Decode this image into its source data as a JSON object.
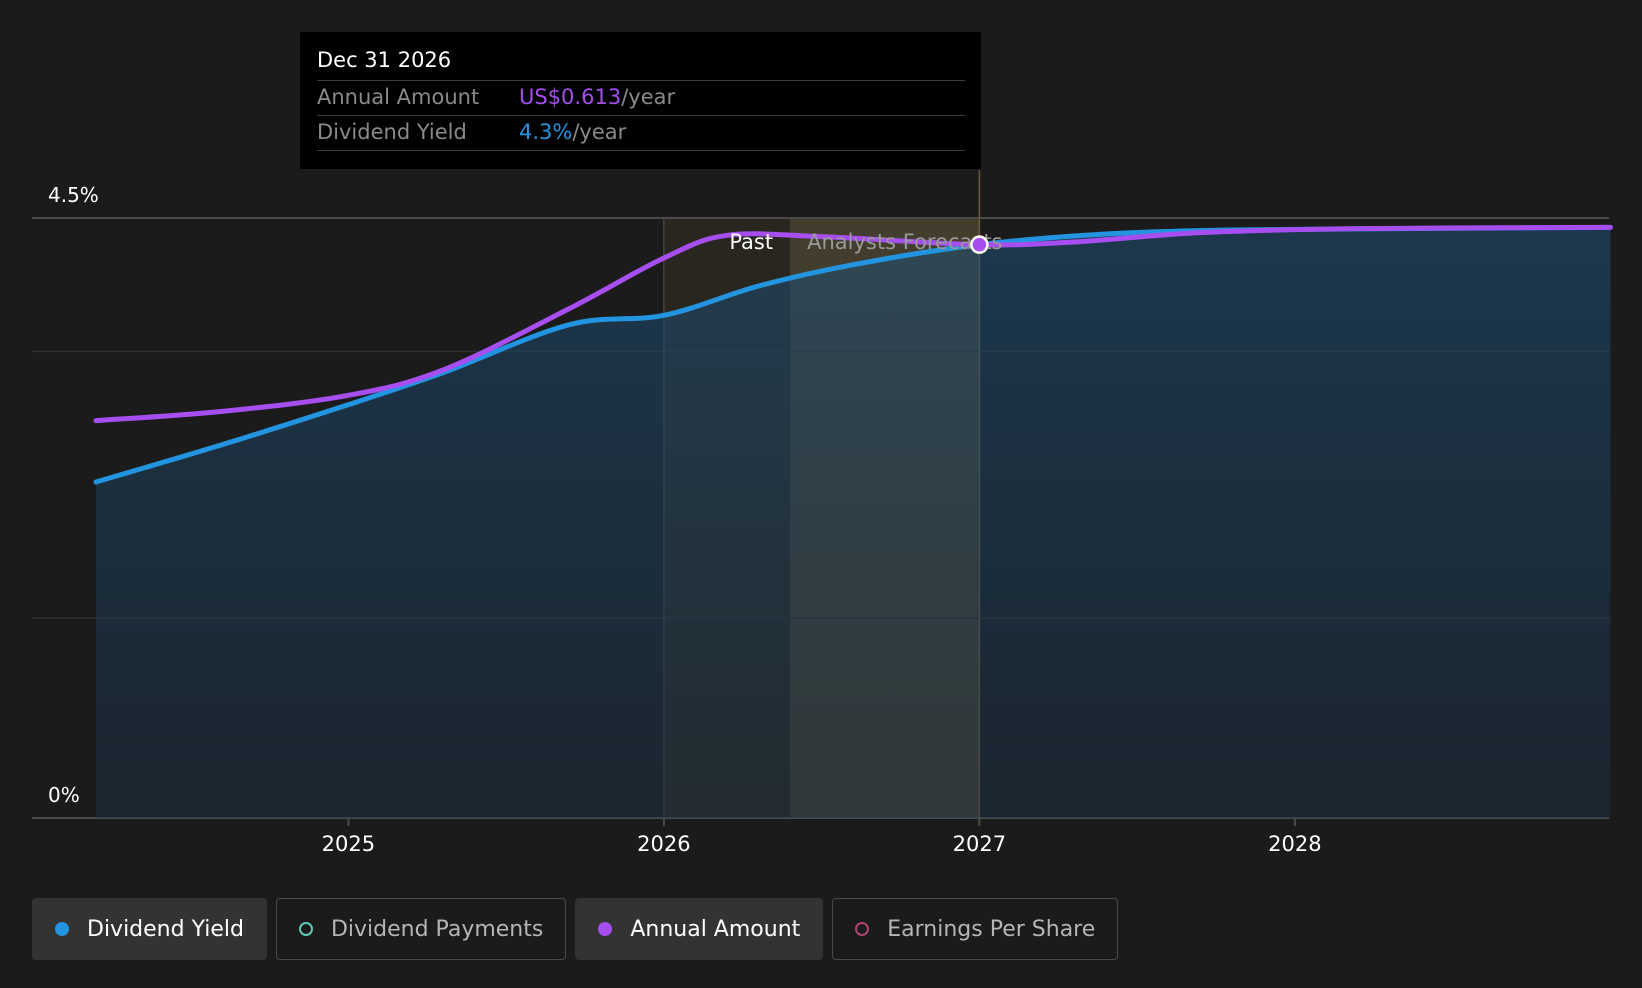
{
  "tooltip": {
    "date": "Dec 31 2026",
    "rows": [
      {
        "label": "Annual Amount",
        "value": "US$0.613",
        "unit": "/year",
        "color": "#a64ef0"
      },
      {
        "label": "Dividend Yield",
        "value": "4.3%",
        "unit": "/year",
        "color": "#2394e0"
      }
    ]
  },
  "regions": {
    "past_label": "Past",
    "forecast_label": "Analysts Forecasts"
  },
  "legend": [
    {
      "label": "Dividend Yield",
      "color": "#2394e0",
      "active": true,
      "marker": "filled",
      "icon": "dividend-yield-dot-icon"
    },
    {
      "label": "Dividend Payments",
      "color": "#5fc7b5",
      "active": false,
      "marker": "hollow",
      "icon": "dividend-payments-dot-icon"
    },
    {
      "label": "Annual Amount",
      "color": "#a64ef0",
      "active": true,
      "marker": "filled",
      "icon": "annual-amount-dot-icon"
    },
    {
      "label": "Earnings Per Share",
      "color": "#b0426f",
      "active": false,
      "marker": "hollow",
      "icon": "earnings-per-share-dot-icon"
    }
  ],
  "chart_data": {
    "type": "line",
    "ylim": [
      0,
      4.5
    ],
    "y_tick_labels": [
      {
        "value": 4.5,
        "label": "4.5%"
      },
      {
        "value": 0,
        "label": "0%"
      }
    ],
    "x_ticks": [
      {
        "value": 2025.0,
        "label": "2025"
      },
      {
        "value": 2026.0,
        "label": "2026"
      },
      {
        "value": 2027.0,
        "label": "2027"
      },
      {
        "value": 2028.0,
        "label": "2028"
      }
    ],
    "x_range": [
      2024.2,
      2029.0
    ],
    "past_band": [
      2026.0,
      2026.4
    ],
    "forecast_band": [
      2026.4,
      2027.0
    ],
    "hover_x": 2027.0,
    "grid": true,
    "series": [
      {
        "name": "Dividend Yield",
        "color": "#2394e0",
        "fill": true,
        "points": [
          [
            2024.2,
            2.52
          ],
          [
            2024.6,
            2.8
          ],
          [
            2025.0,
            3.1
          ],
          [
            2025.3,
            3.34
          ],
          [
            2025.7,
            3.7
          ],
          [
            2026.0,
            3.77
          ],
          [
            2026.3,
            3.99
          ],
          [
            2026.6,
            4.15
          ],
          [
            2027.0,
            4.3
          ],
          [
            2027.4,
            4.38
          ],
          [
            2027.8,
            4.41
          ],
          [
            2028.3,
            4.42
          ],
          [
            2029.0,
            4.43
          ]
        ]
      },
      {
        "name": "Annual Amount",
        "color": "#a64ef0",
        "fill": false,
        "points": [
          [
            2024.2,
            2.98
          ],
          [
            2024.6,
            3.05
          ],
          [
            2025.0,
            3.17
          ],
          [
            2025.3,
            3.36
          ],
          [
            2025.7,
            3.82
          ],
          [
            2026.0,
            4.2
          ],
          [
            2026.2,
            4.37
          ],
          [
            2026.5,
            4.36
          ],
          [
            2027.0,
            4.3
          ],
          [
            2027.3,
            4.32
          ],
          [
            2027.7,
            4.39
          ],
          [
            2028.2,
            4.42
          ],
          [
            2029.0,
            4.43
          ]
        ]
      }
    ]
  }
}
